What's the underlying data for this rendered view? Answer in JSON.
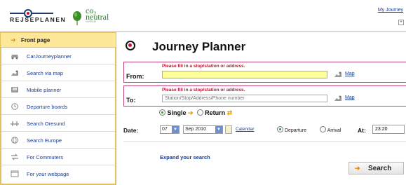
{
  "header": {
    "logo_text": "REJSEPLANEN",
    "co2_line1": "co₂",
    "co2_line2": "neutral",
    "co2_small": "website",
    "my_journey": "My Journey",
    "expand_symbol": "+"
  },
  "sidebar": {
    "front_page": "Front page",
    "items": [
      {
        "label": "CarJourneyplanner",
        "icon": "car-icon"
      },
      {
        "label": "Search via map",
        "icon": "map-pin-icon"
      },
      {
        "label": "Mobile planner",
        "icon": "mobile-icon"
      },
      {
        "label": "Departure boards",
        "icon": "clock-icon"
      },
      {
        "label": "Search Oresund",
        "icon": "bridge-icon"
      },
      {
        "label": "Search Europe",
        "icon": "globe-icon"
      },
      {
        "label": "For Commuters",
        "icon": "commuter-icon"
      },
      {
        "label": "For your webpage",
        "icon": "webpage-icon"
      }
    ]
  },
  "main": {
    "title": "Journey Planner",
    "from": {
      "label": "From:",
      "error": "Please fill in a stop/station or address.",
      "value": "",
      "placeholder": "",
      "map_link": "Map"
    },
    "to": {
      "label": "To:",
      "error": "Please fill in a stop/station or address.",
      "value": "",
      "placeholder": "Station/Stop/Address/Phone number",
      "map_link": "Map"
    },
    "trip": {
      "single": "Single",
      "return": "Return",
      "selected": "single"
    },
    "date": {
      "label": "Date:",
      "day": "07",
      "month_year": "Sep 2010",
      "calendar_link": "Calendar",
      "departure": "Departure",
      "arrival": "Arrival",
      "selected": "departure",
      "at_label": "At:",
      "time": "23:20"
    },
    "expand_search": "Expand your search",
    "search_button": "Search"
  },
  "colors": {
    "link_blue": "#1a3b8f",
    "error_red": "#c8102e",
    "highlight_yellow": "#fde89a",
    "input_yellow": "#ffff99",
    "brand_navy": "#1f3a6e",
    "accent_orange": "#e08a00"
  }
}
